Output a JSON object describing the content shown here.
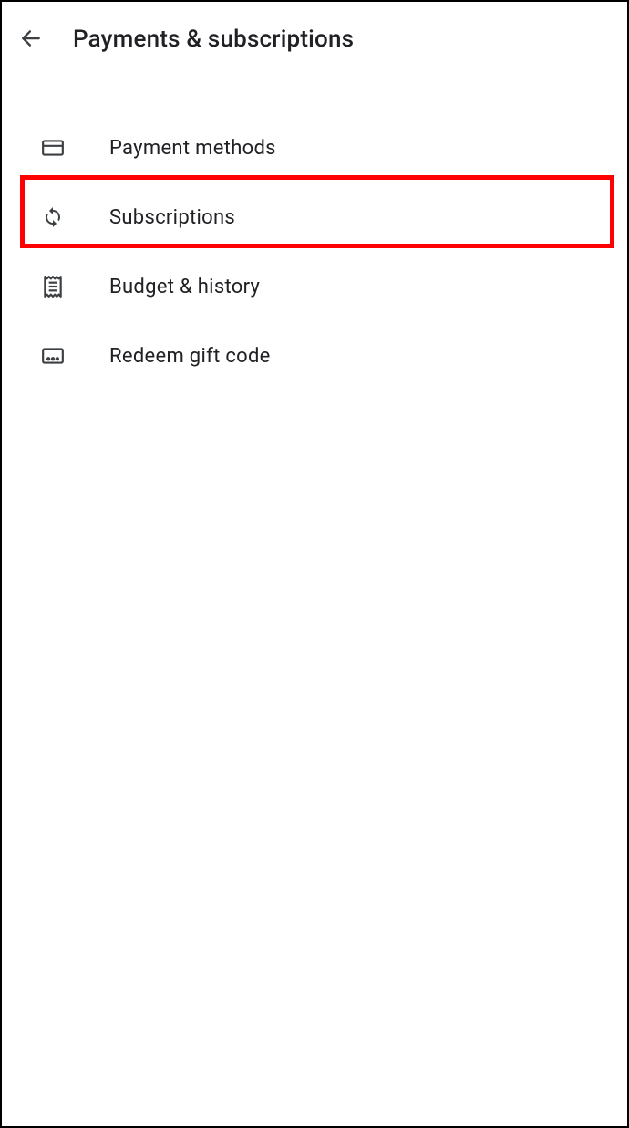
{
  "header": {
    "title": "Payments & subscriptions"
  },
  "menu": {
    "items": [
      {
        "label": "Payment methods",
        "icon": "credit-card-icon"
      },
      {
        "label": "Subscriptions",
        "icon": "sync-icon"
      },
      {
        "label": "Budget & history",
        "icon": "receipt-icon"
      },
      {
        "label": "Redeem gift code",
        "icon": "gift-card-icon"
      }
    ]
  },
  "highlight": {
    "target_index": 1
  }
}
